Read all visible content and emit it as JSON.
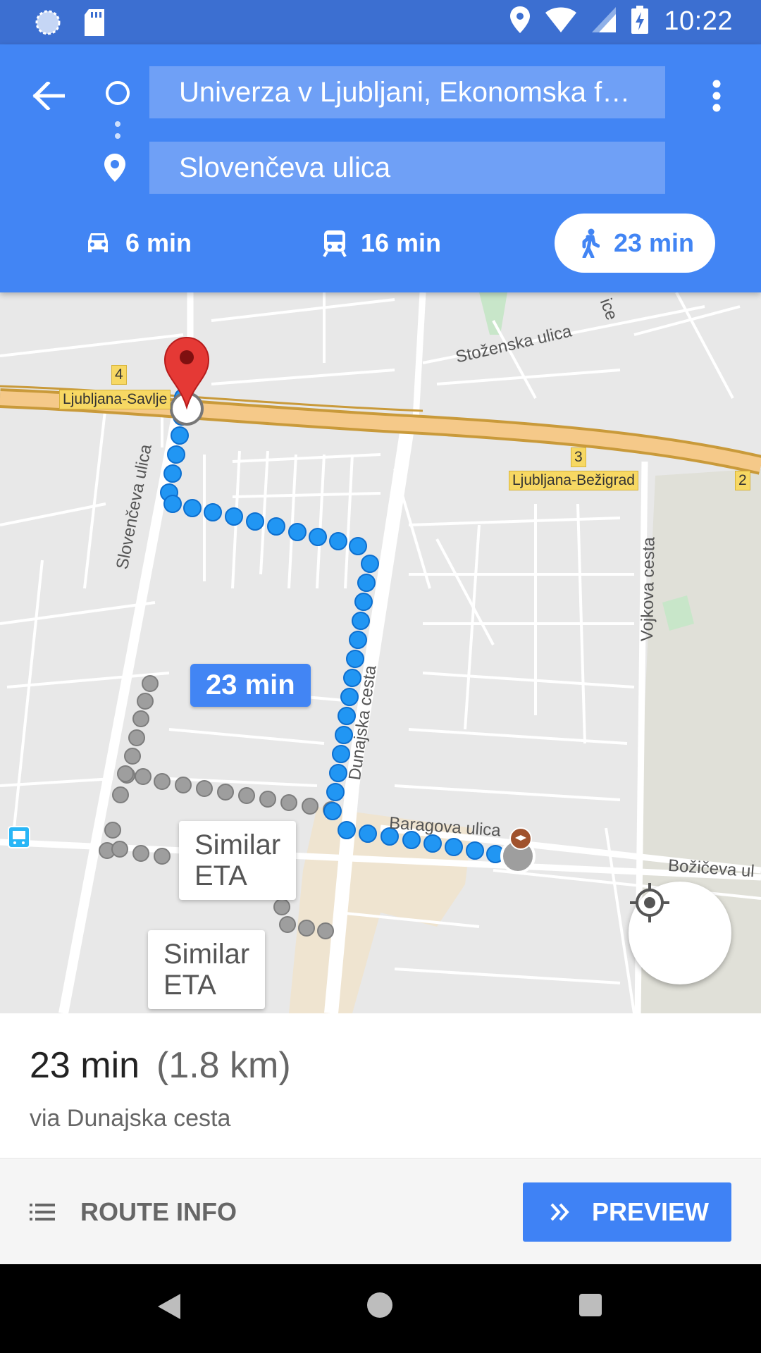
{
  "status_bar": {
    "time": "10:22",
    "icons": [
      "sync-icon",
      "sd-card-icon",
      "location-icon",
      "wifi-icon",
      "signal-icon",
      "battery-charging-icon"
    ]
  },
  "header": {
    "origin": "Univerza v Ljubljani, Ekonomska f…",
    "destination": "Slovenčeva ulica",
    "modes": [
      {
        "name": "drive",
        "icon": "car-icon",
        "label": "6 min"
      },
      {
        "name": "transit",
        "icon": "train-icon",
        "label": "16 min"
      },
      {
        "name": "walk",
        "icon": "walk-icon",
        "label": "23 min",
        "selected": true
      }
    ]
  },
  "map": {
    "labels": {
      "stozenska": "Stoženska ulica",
      "slovenceva": "Slovenčeva ulica",
      "dunajska": "Dunajska cesta",
      "baragova": "Baragova ulica",
      "boziceva": "Božičeva ul",
      "vojkova": "Vojkova cesta",
      "ice": "ice"
    },
    "shields": {
      "savlje": "Ljubljana-Savlje",
      "bezigrad": "Ljubljana-Bežigrad",
      "exit4": "4",
      "exit3": "3",
      "exit2": "2"
    },
    "route_eta": "23 min",
    "alt_routes": [
      {
        "line1": "Similar",
        "line2": "ETA"
      },
      {
        "line1": "Similar",
        "line2": "ETA"
      }
    ],
    "colors": {
      "route": "#2196f3",
      "alt_route": "#9e9e9e",
      "highway": "#f5c989",
      "pin": "#e53935"
    }
  },
  "summary": {
    "time": "23 min",
    "distance": "(1.8 km)",
    "via": "via Dunajska cesta"
  },
  "actions": {
    "route_info": "ROUTE INFO",
    "preview": "PREVIEW"
  }
}
